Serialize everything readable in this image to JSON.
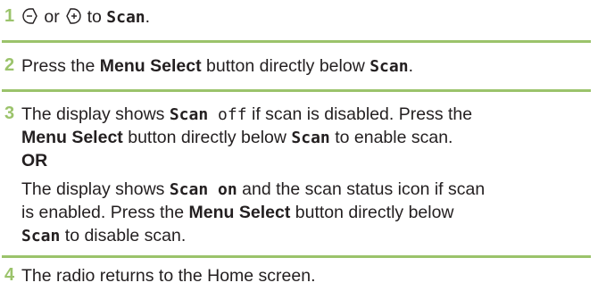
{
  "steps": [
    {
      "number": "1",
      "parts": {
        "or": "or",
        "to": "to",
        "scan": "Scan",
        "period": "."
      },
      "icons": [
        "left-arrow-icon",
        "right-arrow-icon"
      ]
    },
    {
      "number": "2",
      "parts": {
        "press": "Press the",
        "menu_select": "Menu Select",
        "button_below": "button directly below",
        "scan": "Scan",
        "period": "."
      }
    },
    {
      "number": "3",
      "parts": {
        "display_shows": "The display shows",
        "scan_off": "Scan off",
        "if_disabled": "if scan is disabled. Press the",
        "menu_select_1": "Menu Select",
        "button_below_1": "button directly below",
        "scan_1": "Scan",
        "to_enable": "to enable scan.",
        "or_label": "OR",
        "display_shows_2": "The display shows",
        "scan_on": "Scan on",
        "and_status": "and the scan status icon if scan",
        "is_enabled": "is enabled. Press the",
        "menu_select_2": "Menu Select",
        "button_below_2": "button directly below",
        "scan_2": "Scan",
        "to_disable": "to disable scan."
      }
    },
    {
      "number": "4",
      "parts": {
        "text": "The radio returns to the Home screen."
      }
    }
  ],
  "colors": {
    "accent": "#9bc36b",
    "text": "#231f20"
  }
}
